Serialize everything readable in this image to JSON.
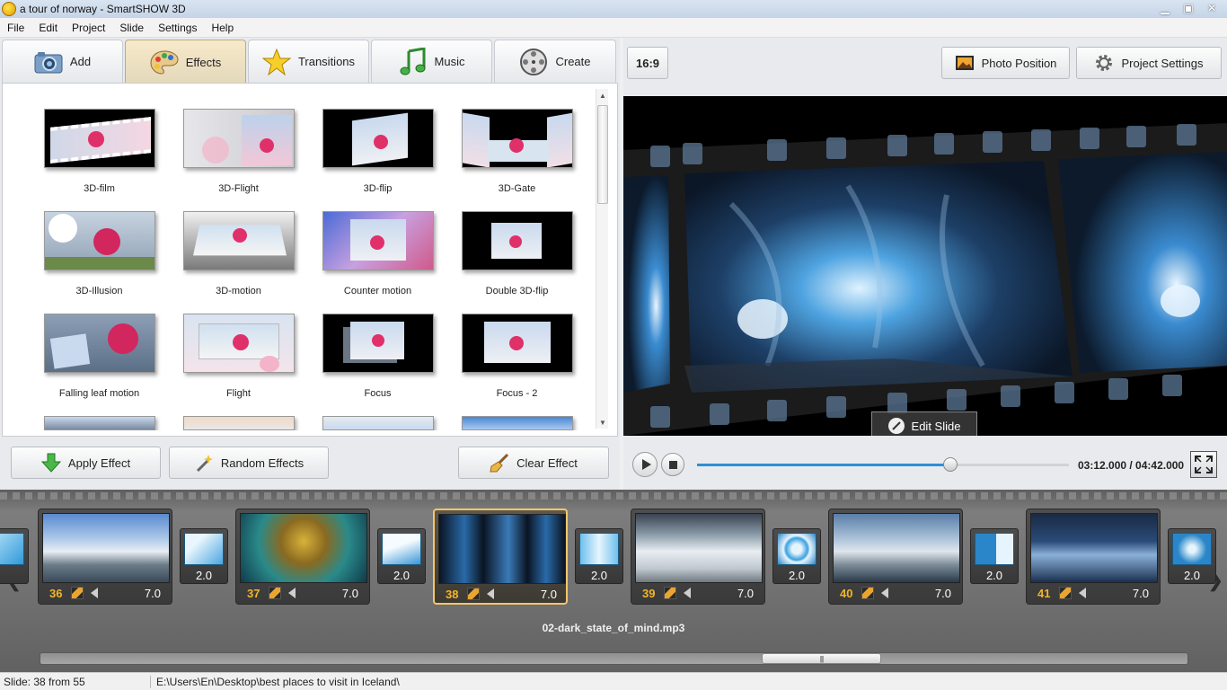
{
  "window": {
    "title": "a tour of norway - SmartSHOW 3D"
  },
  "menu": [
    "File",
    "Edit",
    "Project",
    "Slide",
    "Settings",
    "Help"
  ],
  "tabs": [
    {
      "label": "Add",
      "icon": "camera-icon"
    },
    {
      "label": "Effects",
      "icon": "palette-icon",
      "active": true
    },
    {
      "label": "Transitions",
      "icon": "star-icon"
    },
    {
      "label": "Music",
      "icon": "music-note-icon"
    },
    {
      "label": "Create",
      "icon": "film-reel-icon"
    }
  ],
  "effects": [
    [
      "3D-film",
      "3D-Flight",
      "3D-flip",
      "3D-Gate"
    ],
    [
      "3D-Illusion",
      "3D-motion",
      "Counter motion",
      "Double 3D-flip"
    ],
    [
      "Falling leaf motion",
      "Flight",
      "Focus",
      "Focus - 2"
    ]
  ],
  "effect_buttons": {
    "apply": "Apply Effect",
    "random": "Random Effects",
    "clear": "Clear Effect"
  },
  "preview": {
    "aspect": "16:9",
    "photo_position": "Photo Position",
    "project_settings": "Project Settings",
    "edit_slide": "Edit Slide",
    "time": "03:12.000 / 04:42.000",
    "progress_fraction": 0.68
  },
  "timeline": {
    "slides": [
      {
        "number": "36",
        "duration": "7.0"
      },
      {
        "number": "37",
        "duration": "7.0"
      },
      {
        "number": "38",
        "duration": "7.0",
        "selected": true
      },
      {
        "number": "39",
        "duration": "7.0"
      },
      {
        "number": "40",
        "duration": "7.0"
      },
      {
        "number": "41",
        "duration": "7.0"
      }
    ],
    "transitions": [
      "2.0",
      "2.0",
      "2.0",
      "2.0",
      "2.0",
      "2.0"
    ],
    "music": "02-dark_state_of_mind.mp3"
  },
  "status": {
    "slide": "Slide: 38 from 55",
    "path": "E:\\Users\\En\\Desktop\\best places to visit in Iceland\\"
  },
  "colors": {
    "accent_blue": "#2f8fd6",
    "slide_number": "#f3b52a",
    "selected_border": "#f3c66a"
  }
}
